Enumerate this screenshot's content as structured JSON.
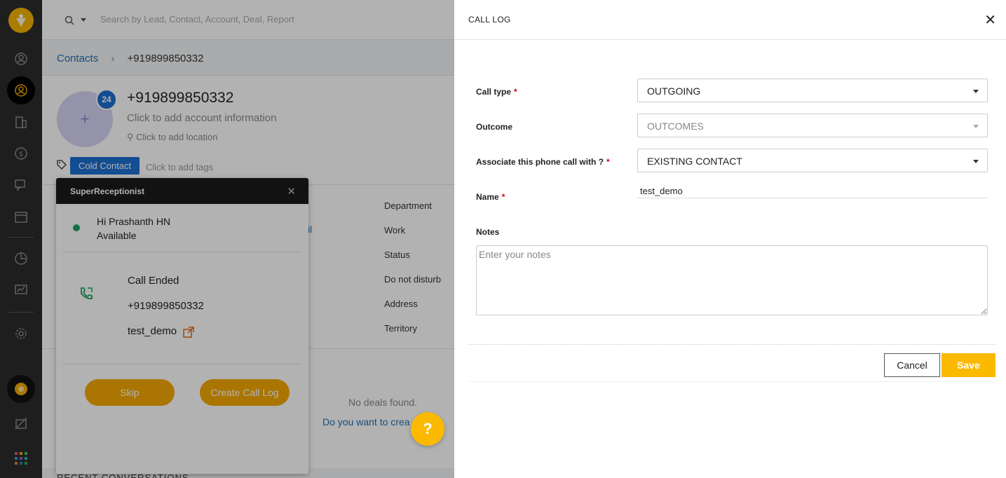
{
  "search": {
    "placeholder": "Search by Lead, Contact, Account, Deal, Report"
  },
  "breadcrumb": {
    "parent": "Contacts",
    "current": "+919899850332"
  },
  "contact": {
    "badge": "24",
    "phone": "+919899850332",
    "account_hint": "Click to add account information",
    "location_hint": "Click to add location",
    "tag": "Cold Contact",
    "tag_hint": "Click to add tags",
    "detail_labels": [
      "Department",
      "Work",
      "Status",
      "Do not disturb",
      "Address",
      "Territory"
    ],
    "detail_link_fragment": "ail"
  },
  "deals": {
    "empty": "No deals found.",
    "create_prompt": "Do you want to crea"
  },
  "recent": {
    "heading": "RECENT CONVERSATIONS"
  },
  "superreceptionist": {
    "title": "SuperReceptionist",
    "greeting": "Hi Prashanth HN",
    "availability": "Available",
    "call_status": "Call Ended",
    "call_number": "+919899850332",
    "call_contact": "test_demo",
    "skip_label": "Skip",
    "create_label": "Create Call Log"
  },
  "help": {
    "label": "?"
  },
  "call_log": {
    "title": "CALL LOG",
    "call_type_label": "Call type",
    "call_type_value": "OUTGOING",
    "outcome_label": "Outcome",
    "outcome_value": "OUTCOMES",
    "associate_label": "Associate this phone call with ?",
    "associate_value": "EXISTING CONTACT",
    "name_label": "Name",
    "name_value": "test_demo",
    "notes_label": "Notes",
    "notes_placeholder": "Enter your notes",
    "cancel_label": "Cancel",
    "save_label": "Save",
    "required_mark": "*"
  },
  "colors": {
    "accent": "#fbb900",
    "primary_blue": "#1f6fd0",
    "available_green": "#1fa463",
    "required_red": "#d0021b"
  }
}
